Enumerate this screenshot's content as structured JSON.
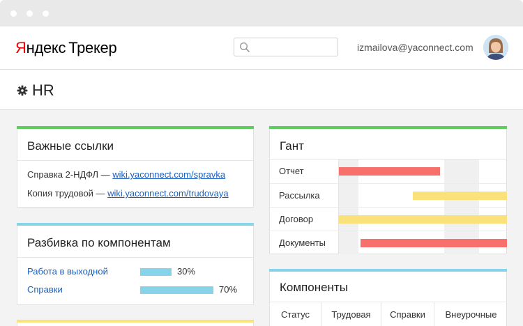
{
  "header": {
    "logo_brand_first": "Я",
    "logo_brand_rest": "ндекс",
    "logo_product": "Трекер",
    "search_placeholder": "",
    "user_email": "izmailova@yaconnect.com"
  },
  "queue": {
    "title": "HR",
    "icon": "gear-icon"
  },
  "links_card": {
    "title": "Важные ссылки",
    "accent_color": "#5dce5d",
    "items": [
      {
        "label": "Справка 2-НДФЛ — ",
        "link": "wiki.yaconnect.com/spravka"
      },
      {
        "label": "Копия трудовой — ",
        "link": "wiki.yaconnect.com/trudovaya"
      }
    ]
  },
  "components_card": {
    "title": "Разбивка по компонентам",
    "accent_color": "#87d3ea",
    "items": [
      {
        "label": "Работа в выходной",
        "percent_text": "30%",
        "value": 30
      },
      {
        "label": "Справки",
        "percent_text": "70%",
        "value": 70
      }
    ]
  },
  "bottom_card": {
    "accent_color": "#fbe17a"
  },
  "gantt_card": {
    "title": "Гант",
    "accent_color": "#5dce5d",
    "red_color": "#f8706b",
    "yellow_color": "#fbe17a",
    "rows": [
      {
        "label": "Отчет",
        "start": 0.0,
        "end": 0.6,
        "color": "red"
      },
      {
        "label": "Рассылка",
        "start": 0.44,
        "end": 1.0,
        "color": "yellow"
      },
      {
        "label": "Договор",
        "start": 0.0,
        "end": 1.0,
        "color": "yellow"
      },
      {
        "label": "Документы",
        "start": 0.13,
        "end": 1.0,
        "color": "red"
      }
    ]
  },
  "components_table": {
    "title": "Компоненты",
    "accent_color": "#87d3ea",
    "columns": [
      "Статус",
      "Трудовая",
      "Справки",
      "Внеурочные"
    ]
  }
}
